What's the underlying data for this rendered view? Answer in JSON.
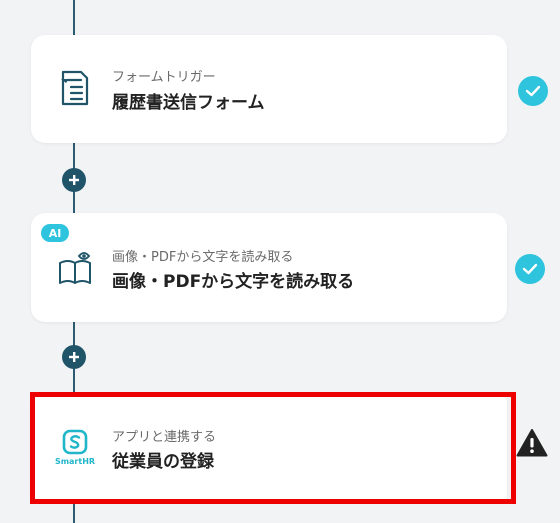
{
  "steps": [
    {
      "subtitle": "フォームトリガー",
      "title": "履歴書送信フォーム",
      "icon": "form-trigger-icon",
      "status": "complete"
    },
    {
      "badge": "AI",
      "subtitle": "画像・PDFから文字を読み取る",
      "title": "画像・PDFから文字を読み取る",
      "icon": "book-eye-ocr-icon",
      "status": "complete"
    },
    {
      "subtitle": "アプリと連携する",
      "title": "従業員の登録",
      "icon": "smarthr-logo-icon",
      "app_logo_text": "SmartHR",
      "status": "warning"
    }
  ],
  "colors": {
    "background": "#f2f3f5",
    "connector": "#2b5b71",
    "add_button": "#1f5469",
    "check": "#2ec4dd",
    "ai_badge": "#2ec4dd",
    "highlight": "#ee0000",
    "warning": "#222222",
    "smarthr": "#1fb6c9"
  }
}
